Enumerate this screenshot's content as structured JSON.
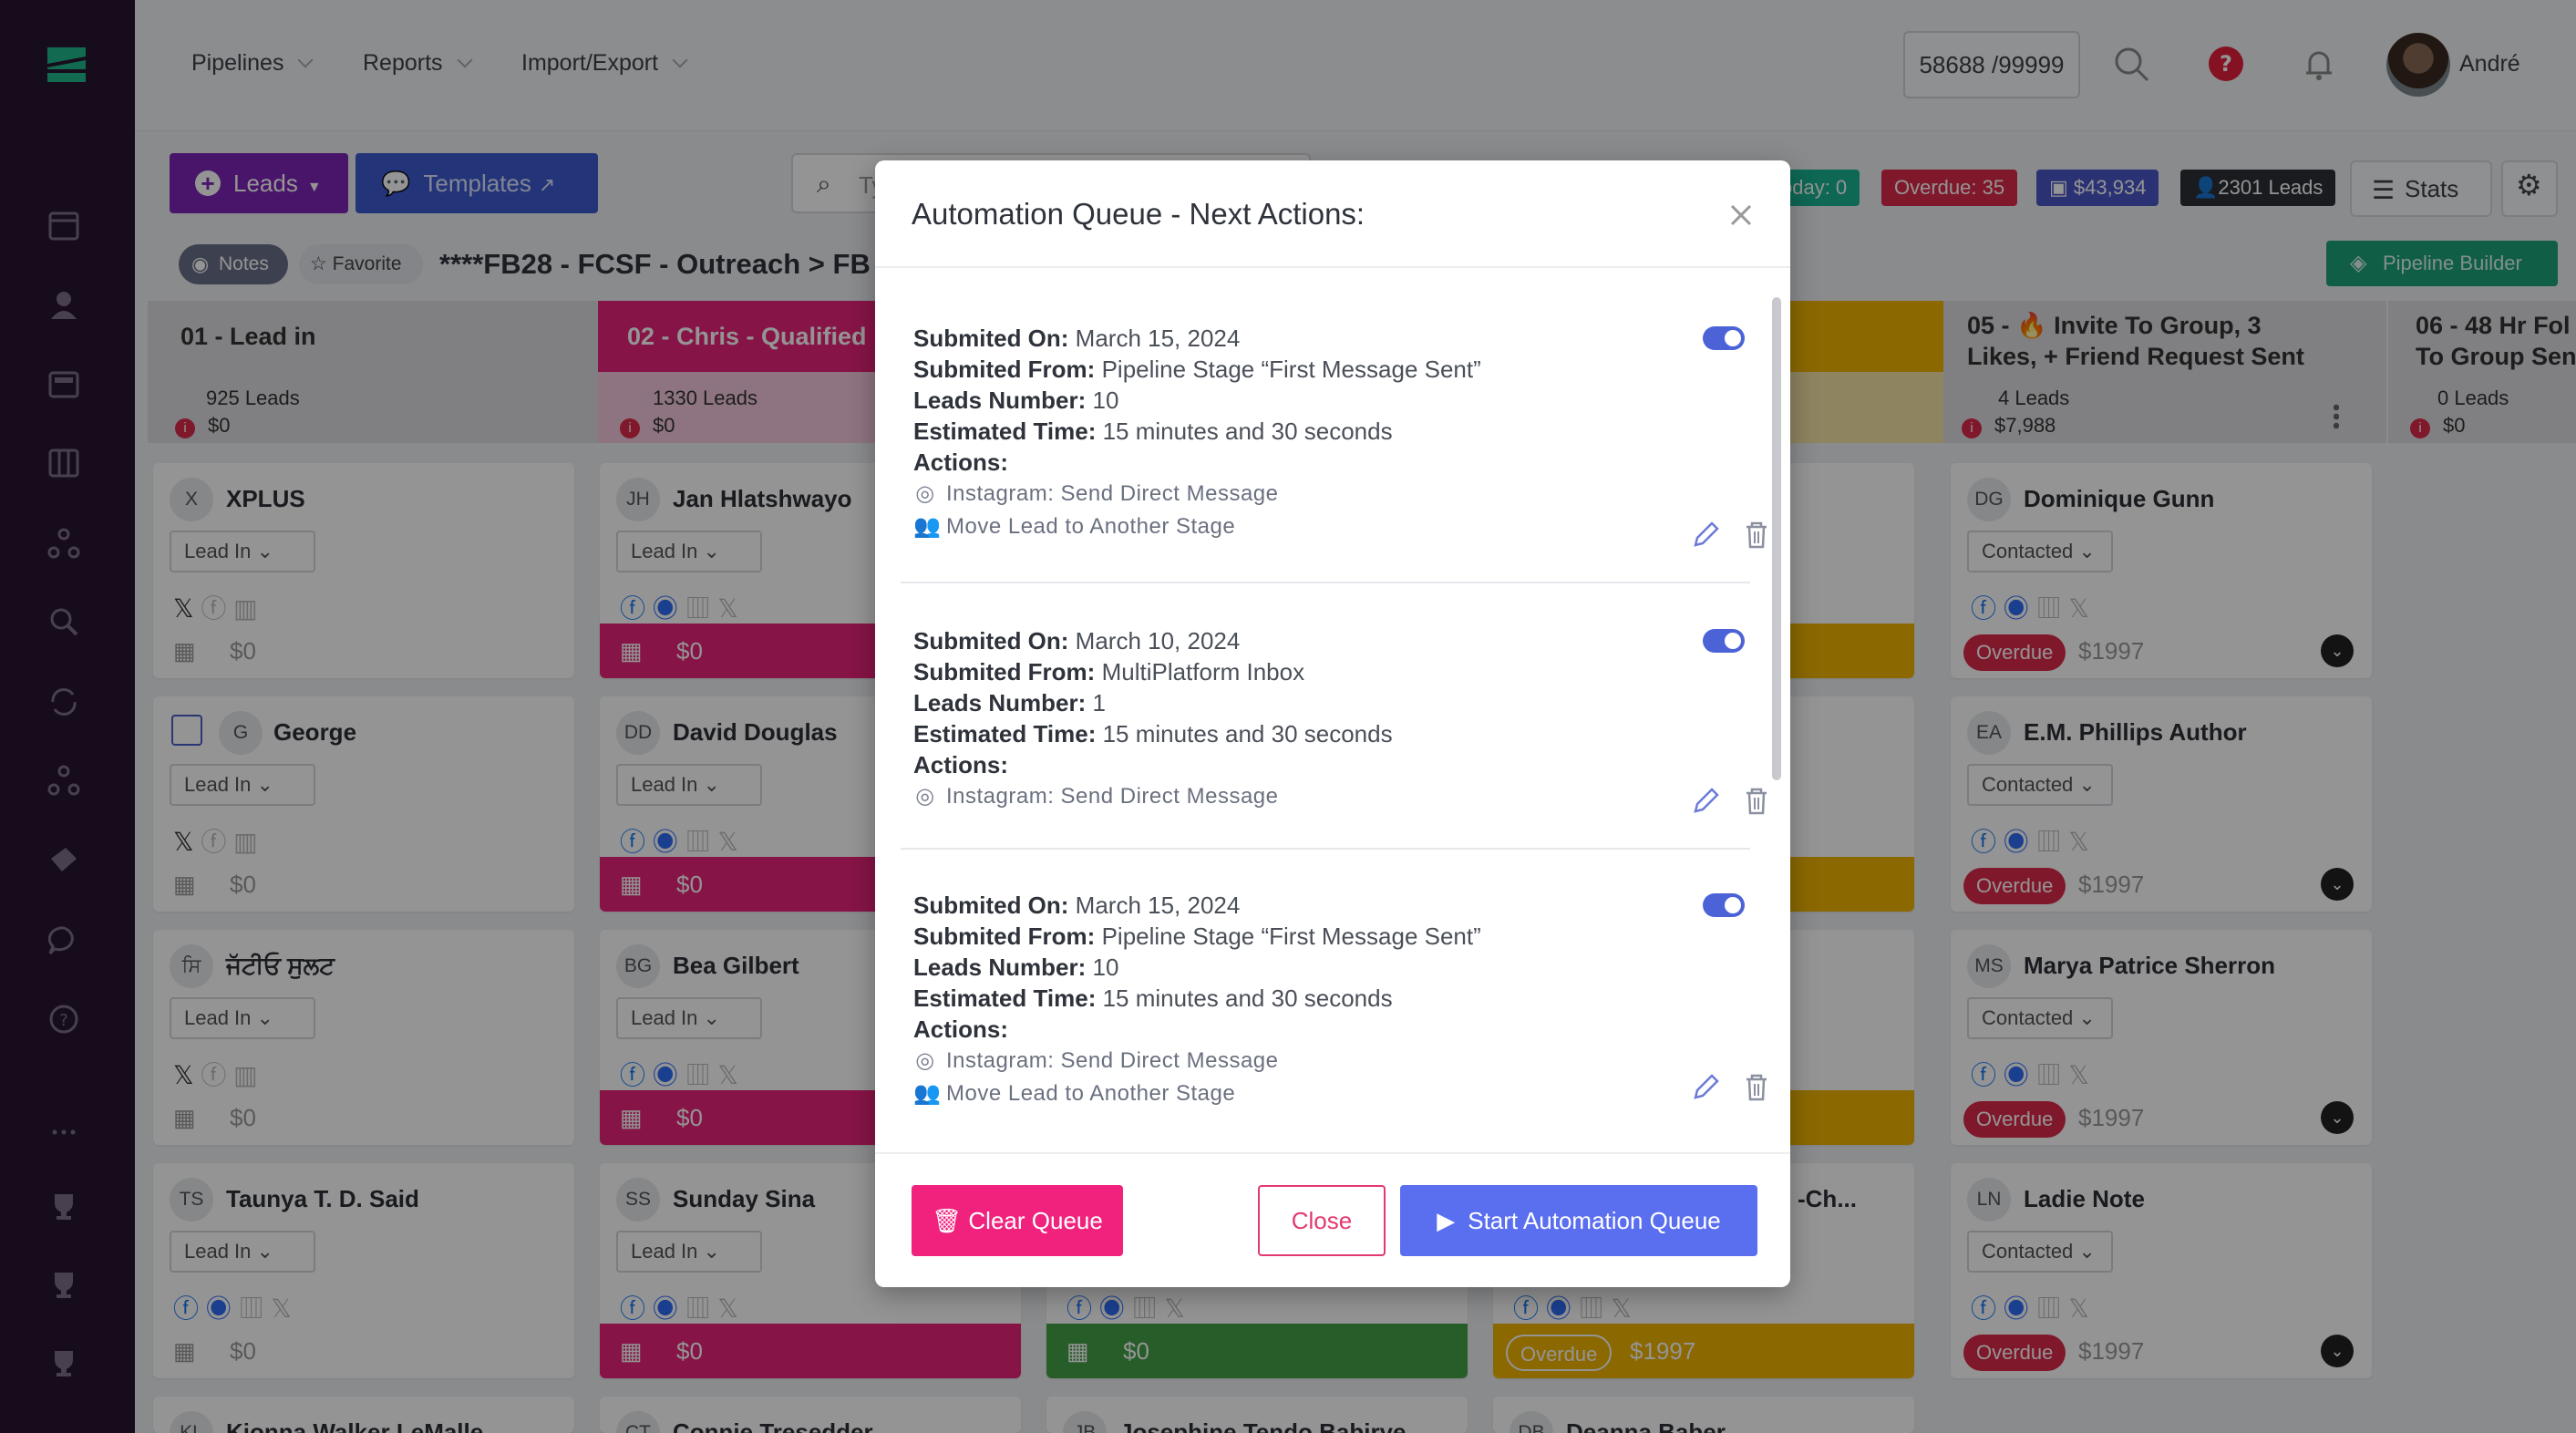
{
  "nav": {
    "pipelines": "Pipelines",
    "reports": "Reports",
    "import_export": "Import/Export"
  },
  "counter": "58688 /99999",
  "user": {
    "name": "André"
  },
  "toolbar": {
    "leads": "Leads",
    "templates": "Templates",
    "search_placeholder": "Ty",
    "today": "oday: 0",
    "overdue": "Overdue: 35",
    "value": "$43,934",
    "lead_count": "2301 Leads",
    "stats": "Stats"
  },
  "pipeline": {
    "notes": "Notes",
    "favorite": "Favorite",
    "name": "****FB28 - FCSF - Outreach > FB",
    "builder": "Pipeline Builder"
  },
  "columns": [
    {
      "title": "01 - Lead in",
      "count": "925 Leads",
      "amount": "$0"
    },
    {
      "title": "02 - Chris - Qualified",
      "count": "1330 Leads",
      "amount": "$0"
    },
    {
      "title_line1": "05 - 🔥 Invite To Group, 3",
      "title_line2": "Likes, + Friend Request Sent",
      "count": "4 Leads",
      "amount": "$7,988"
    },
    {
      "title_line1": "06 - 48 Hr Fol",
      "title_line2": "To Group Sent",
      "count": "0 Leads",
      "amount": "$0"
    }
  ],
  "cards_col1": [
    {
      "initials": "X",
      "name": "XPLUS",
      "stage": "Lead In",
      "amount": "$0"
    },
    {
      "initials": "G",
      "name": "George",
      "stage": "Lead In",
      "amount": "$0"
    },
    {
      "initials": "ਸਿ",
      "name": "ਜੱਟੀਓ ਸੁਲਟ",
      "stage": "Lead In",
      "amount": "$0"
    },
    {
      "initials": "TS",
      "name": "Taunya T. D. Said",
      "stage": "Lead In",
      "amount": "$0"
    },
    {
      "initials": "KL",
      "name": "Kionna Walker LeMalle"
    }
  ],
  "cards_col2": [
    {
      "initials": "JH",
      "name": "Jan Hlatshwayo",
      "stage": "Lead In",
      "amount": "$0"
    },
    {
      "initials": "DD",
      "name": "David Douglas",
      "stage": "Lead In",
      "amount": "$0"
    },
    {
      "initials": "BG",
      "name": "Bea Gilbert",
      "stage": "Lead In",
      "amount": "$0"
    },
    {
      "initials": "SS",
      "name": "Sunday Sina",
      "stage": "Lead In",
      "amount": "$0"
    },
    {
      "initials": "CT",
      "name": "Connie Tresedder"
    }
  ],
  "cards_col3": [
    {
      "amount": "$0"
    },
    {
      "initials": "JB",
      "name": "Josephine Tendo Babirye"
    }
  ],
  "cards_col4": [
    {
      "name": "-Ch...",
      "overdue": "Overdue",
      "amount": "$1997"
    },
    {
      "initials": "DB",
      "name": "Deanna Baber"
    }
  ],
  "cards_col5": [
    {
      "initials": "DG",
      "name": "Dominique Gunn",
      "stage": "Contacted",
      "overdue": "Overdue",
      "amount": "$1997"
    },
    {
      "initials": "EA",
      "name": "E.M. Phillips Author",
      "stage": "Contacted",
      "overdue": "Overdue",
      "amount": "$1997"
    },
    {
      "initials": "MS",
      "name": "Marya Patrice Sherron",
      "stage": "Contacted",
      "overdue": "Overdue",
      "amount": "$1997"
    },
    {
      "initials": "LN",
      "name": "Ladie Note",
      "stage": "Contacted",
      "overdue": "Overdue",
      "amount": "$1997"
    }
  ],
  "modal": {
    "title": "Automation Queue - Next Actions:",
    "labels": {
      "submitted_on": "Submited On:",
      "submitted_from": "Submited From:",
      "leads_number": "Leads Number:",
      "estimated_time": "Estimated Time:",
      "actions": "Actions:"
    },
    "items": [
      {
        "submitted_on": "March 15, 2024",
        "submitted_from": "Pipeline Stage “First Message Sent”",
        "leads_number": "10",
        "estimated_time": "15 minutes and 30 seconds",
        "actions": [
          "Instagram: Send Direct Message",
          "Move Lead to Another Stage"
        ],
        "enabled": true
      },
      {
        "submitted_on": "March 10, 2024",
        "submitted_from": "MultiPlatform Inbox",
        "leads_number": "1",
        "estimated_time": "15 minutes and 30 seconds",
        "actions": [
          "Instagram: Send Direct Message"
        ],
        "enabled": true
      },
      {
        "submitted_on": "March 15, 2024",
        "submitted_from": "Pipeline Stage “First Message Sent”",
        "leads_number": "10",
        "estimated_time": "15 minutes and 30 seconds",
        "actions": [
          "Instagram: Send Direct Message",
          "Move Lead to Another Stage"
        ],
        "enabled": true
      }
    ],
    "clear": "Clear Queue",
    "close": "Close",
    "start": "Start Automation Queue"
  },
  "colors": {
    "sidebar": "#29152f",
    "accent": "#5a6ef0",
    "pink": "#f0227d",
    "purple": "#7e25b8",
    "green": "#1ea27a",
    "yellow": "#f0b400",
    "overdue": "#dd2a4a"
  }
}
